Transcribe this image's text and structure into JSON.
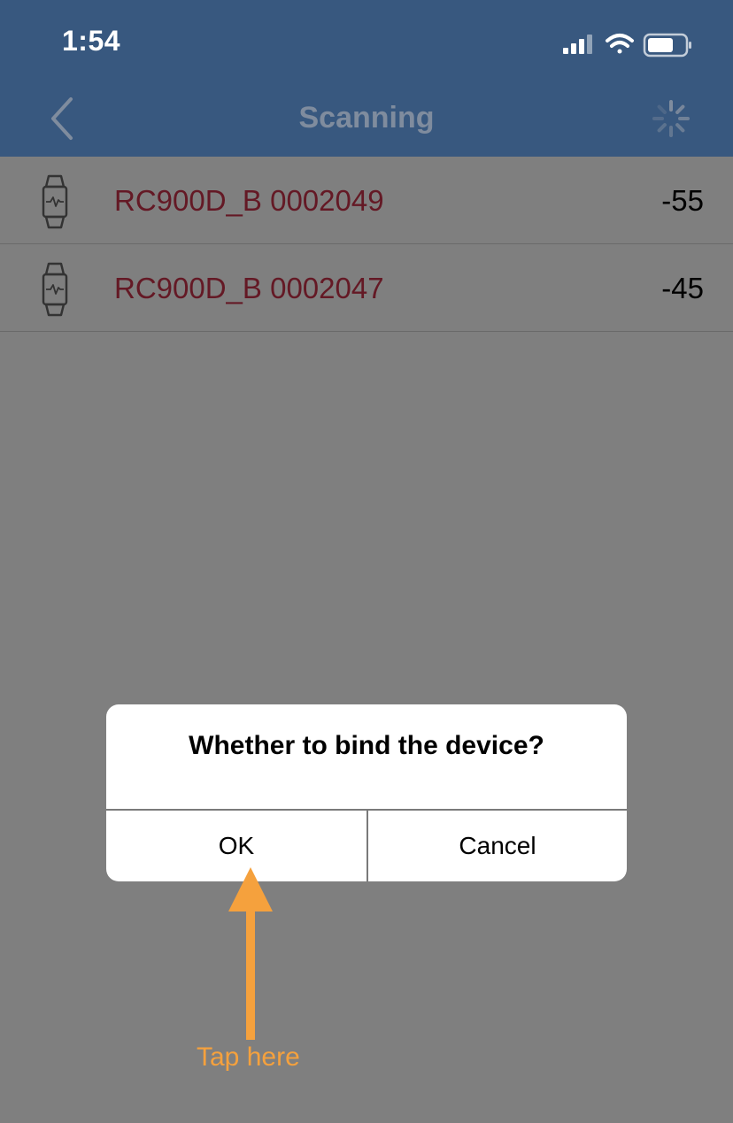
{
  "status_bar": {
    "time": "1:54",
    "icons": [
      "cellular-signal-icon",
      "wifi-icon",
      "battery-icon"
    ]
  },
  "nav": {
    "title": "Scanning",
    "back_icon": "chevron-left-icon",
    "loading_icon": "activity-spinner-icon"
  },
  "devices": [
    {
      "icon": "watch-icon",
      "name": "RC900D_B 0002049",
      "rssi": "-55"
    },
    {
      "icon": "watch-icon",
      "name": "RC900D_B 0002047",
      "rssi": "-45"
    }
  ],
  "dialog": {
    "message": "Whether to bind the device?",
    "ok_label": "OK",
    "cancel_label": "Cancel"
  },
  "annotation": {
    "hint": "Tap here",
    "color": "#f5a13d"
  },
  "colors": {
    "header_bg": "#38587f",
    "device_name": "#c9334a"
  }
}
